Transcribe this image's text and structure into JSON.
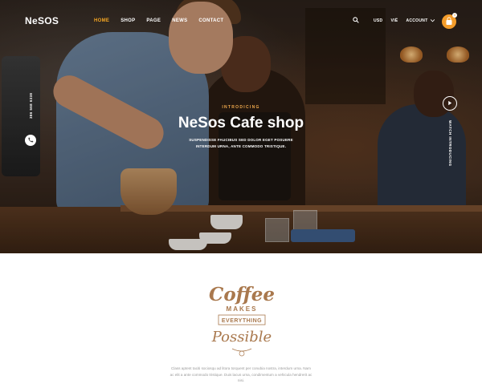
{
  "brand": {
    "logo": "NeSOS",
    "accent": "#f39c2b"
  },
  "nav": {
    "items": [
      {
        "label": "HOME",
        "active": true
      },
      {
        "label": "SHOP",
        "active": false
      },
      {
        "label": "PAGE",
        "active": false
      },
      {
        "label": "NEWS",
        "active": false
      },
      {
        "label": "CONTACT",
        "active": false
      }
    ],
    "currency": "USD",
    "language": "VIЁ",
    "account": "ACCOUNT",
    "cart_count": "0",
    "icons": [
      "search-icon",
      "cart-icon",
      "chevron-down-icon"
    ]
  },
  "hero": {
    "eyebrow": "INTRODICING",
    "title": "NeSos Cafe shop",
    "subtitle": "SUSPENDISSE FAUCIBUS SED DOLOR EGET POSUERE INTERDUM URNA, ANTE COMMODO TRISTIQUE.",
    "phone": "386 568 6338",
    "watch_label": "WATCH INTRODUCING",
    "icons": [
      "phone-icon",
      "play-icon"
    ]
  },
  "about": {
    "emblem": {
      "line1": "Coffee",
      "line2": "MAKES",
      "line3": "EVERYTHING",
      "line4": "Possible"
    },
    "text": "Class aptent taciti sociosqu ad litora torquent per conubia nostra, interdum urna. Nam ac elit a ante commodo tristique. Duis lacus urna, condimentum a vehicula hendrerit ac nisi."
  }
}
